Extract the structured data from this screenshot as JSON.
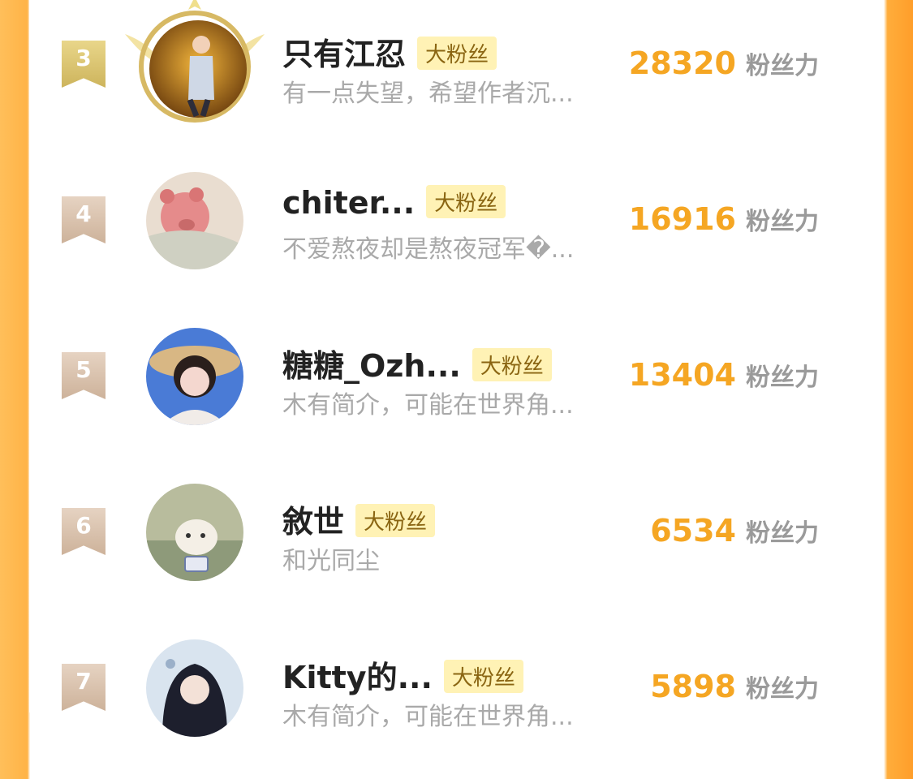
{
  "colors": {
    "accent": "#f5a623",
    "badge_bg": "#fff2b5",
    "badge_text": "#8a6512"
  },
  "score_unit": "粉丝力",
  "rows": [
    {
      "rank": "3",
      "name": "只有江忍",
      "badge": "大粉丝",
      "bio": "有一点失望，希望作者沉...",
      "score": "28320",
      "rank_style": "gold"
    },
    {
      "rank": "4",
      "name": "chiter...",
      "badge": "大粉丝",
      "bio": "不爱熬夜却是熬夜冠军�...",
      "score": "16916",
      "rank_style": "plain"
    },
    {
      "rank": "5",
      "name": "糖糖_Ozh...",
      "badge": "大粉丝",
      "bio": "木有简介，可能在世界角...",
      "score": "13404",
      "rank_style": "plain"
    },
    {
      "rank": "6",
      "name": "敘世",
      "badge": "大粉丝",
      "bio": "和光同尘",
      "score": "6534",
      "rank_style": "plain"
    },
    {
      "rank": "7",
      "name": "Kitty的...",
      "badge": "大粉丝",
      "bio": "木有简介，可能在世界角...",
      "score": "5898",
      "rank_style": "plain"
    }
  ]
}
